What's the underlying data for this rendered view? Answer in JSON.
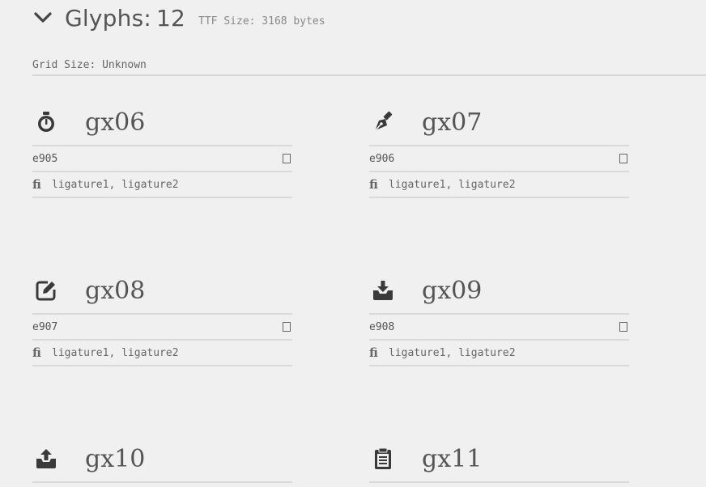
{
  "header": {
    "title_label": "Glyphs:",
    "title_count": "12",
    "ttf_size": "TTF Size: 3168 bytes"
  },
  "grid_size": "Grid Size: Unknown",
  "glyphs": [
    {
      "name": "gx06",
      "code": "e905",
      "ligatures": "ligature1, ligature2",
      "icon": "stopwatch-icon",
      "char": "□",
      "fi": "fi"
    },
    {
      "name": "gx07",
      "code": "e906",
      "ligatures": "ligature1, ligature2",
      "icon": "pen-nib-icon",
      "char": "□",
      "fi": "fi"
    },
    {
      "name": "gx08",
      "code": "e907",
      "ligatures": "ligature1, ligature2",
      "icon": "edit-icon",
      "char": "□",
      "fi": "fi"
    },
    {
      "name": "gx09",
      "code": "e908",
      "ligatures": "ligature1, ligature2",
      "icon": "download-tray-icon",
      "char": "□",
      "fi": "fi"
    },
    {
      "name": "gx10",
      "icon": "upload-tray-icon"
    },
    {
      "name": "gx11",
      "icon": "clipboard-icon"
    }
  ]
}
